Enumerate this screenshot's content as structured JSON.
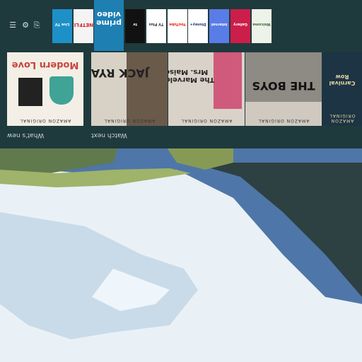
{
  "apps": [
    {
      "name": "Live TV",
      "label": "Live TV",
      "icon": "tv-icon",
      "color": "#1e90c8"
    },
    {
      "name": "Netflix",
      "label": "NETFLIX",
      "icon": "netflix-logo",
      "color": "#f4f4f4"
    },
    {
      "name": "Prime Video",
      "label": "prime\nvideo",
      "icon": "prime-video-logo",
      "color": "#1e7fb3"
    },
    {
      "name": "Apple TV",
      "label": "tv",
      "icon": "apple-tv-logo",
      "color": "#111111"
    },
    {
      "name": "Samsung TV Plus",
      "label": "TV Plus",
      "icon": "tv-plus-logo",
      "color": "#ffffff"
    },
    {
      "name": "YouTube",
      "label": "YouTube",
      "icon": "youtube-logo",
      "color": "#ffffff"
    },
    {
      "name": "Disney+",
      "label": "Disney+",
      "icon": "disney-logo",
      "color": "#ffffff"
    },
    {
      "name": "Internet",
      "label": "Internet",
      "icon": "globe-icon",
      "color": "#5a7ce6"
    },
    {
      "name": "Gallery",
      "label": "Gallery",
      "icon": "flower-icon",
      "color": "#cc1e4a"
    },
    {
      "name": "Welcome",
      "label": "Welcome",
      "icon": "welcome-icon",
      "color": "#eef3ea"
    }
  ],
  "controls": [
    {
      "name": "menu-icon",
      "glyph": "☰"
    },
    {
      "name": "settings-icon",
      "glyph": "⚙"
    },
    {
      "name": "source-icon",
      "glyph": "⎘"
    }
  ],
  "rows": [
    {
      "label": "What's new"
    },
    {
      "label": "Watch next"
    }
  ],
  "posters": [
    {
      "title": "Modern Love",
      "tag": "AMAZON ORIGINAL",
      "bg": "#f3efe6",
      "fg": "#c7463e"
    },
    {
      "title": "JACK RYAN",
      "tag": "AMAZON ORIGINAL",
      "bg": "#d8d1c6",
      "fg": "#222222"
    },
    {
      "title": "The Marvelous Mrs. Maisel",
      "tag": "AMAZON ORIGINAL",
      "bg": "#d9d2c9",
      "fg": "#222222"
    },
    {
      "title": "THE BOYS",
      "tag": "AMAZON ORIGINAL",
      "bg": "#cfc9c0",
      "fg": "#111111"
    },
    {
      "title": "Carnival Row",
      "tag": "AMAZON ORIGINAL",
      "bg": "#1c3443",
      "fg": "#e7d6a4"
    }
  ]
}
